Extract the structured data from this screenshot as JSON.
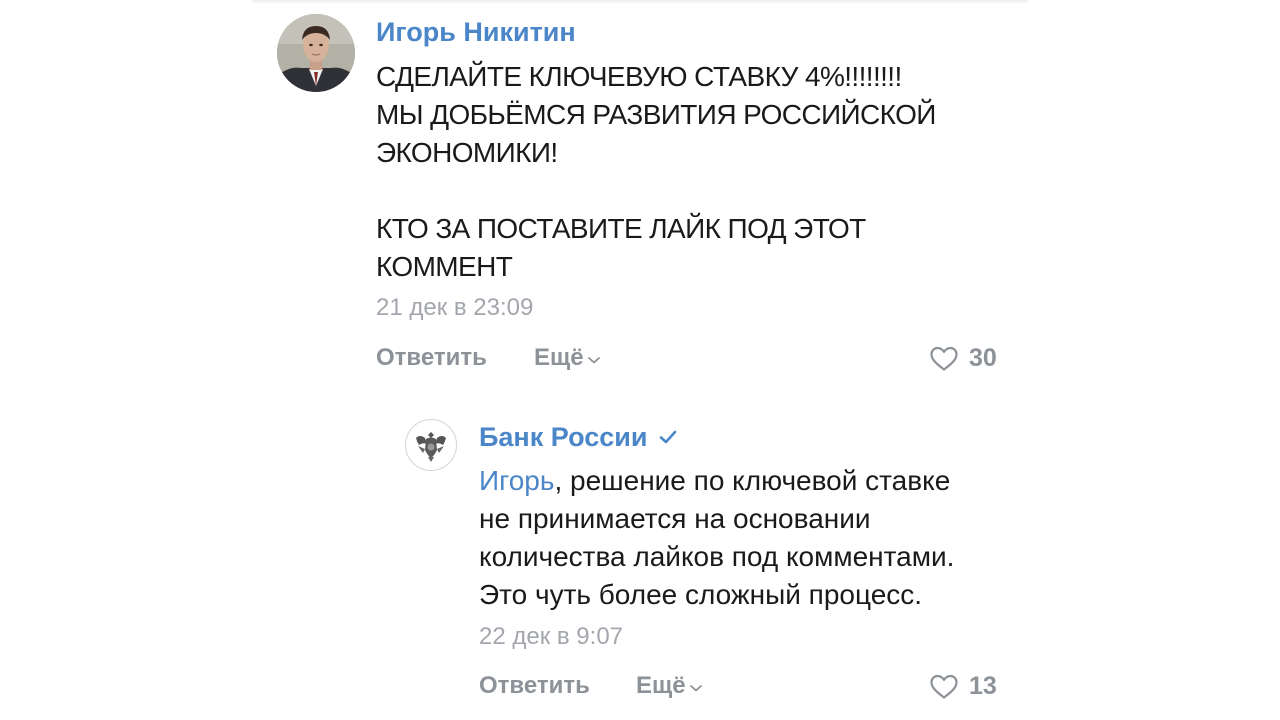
{
  "comment": {
    "author": "Игорь Никитин",
    "lines": [
      "СДЕЛАЙТЕ КЛЮЧЕВУЮ СТАВКУ 4%!!!!!!!!",
      "МЫ ДОБЬЁМСЯ РАЗВИТИЯ РОССИЙСКОЙ",
      "ЭКОНОМИКИ!",
      "",
      "КТО ЗА ПОСТАВИТЕ ЛАЙК ПОД ЭТОТ",
      "КОММЕНТ"
    ],
    "timestamp": "21 дек в 23:09",
    "reply_label": "Ответить",
    "more_label": "Ещё",
    "like_count": "30"
  },
  "reply": {
    "author": "Банк России",
    "verified": true,
    "mention": "Игорь",
    "first_line_rest": ", решение по ключевой ставке",
    "lines": [
      "не принимается на основании",
      "количества лайков под комментами.",
      "Это чуть более сложный процесс."
    ],
    "timestamp": "22 дек в 9:07",
    "reply_label": "Ответить",
    "more_label": "Ещё",
    "like_count": "13"
  },
  "icons": {
    "like": "heart-outline-icon",
    "more": "chevron-down-icon",
    "verified": "checkmark-icon",
    "bank_logo": "double-headed-eagle-icon"
  },
  "colors": {
    "link": "#4a86c8",
    "text": "#1a1a1a",
    "muted": "#a3a7ad",
    "action": "#8d9298"
  }
}
